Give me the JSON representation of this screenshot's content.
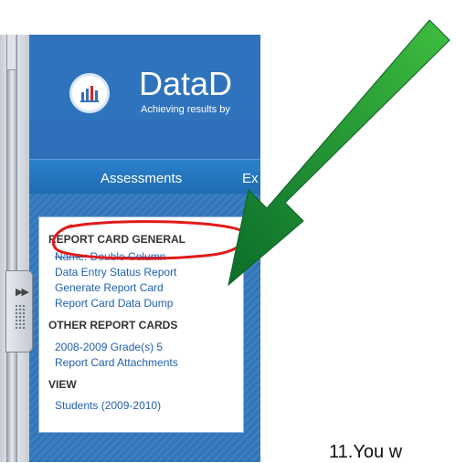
{
  "app": {
    "brand": "DataD",
    "tagline": "Achieving results by"
  },
  "nav": {
    "items": [
      {
        "label": "Assessments"
      },
      {
        "label": "Ex"
      }
    ]
  },
  "menu": {
    "sections": [
      {
        "heading": "REPORT CARD GENERAL",
        "links": [
          {
            "label": "Name: Double Column"
          },
          {
            "label": "Data Entry Status Report"
          },
          {
            "label": "Generate Report Card"
          },
          {
            "label": "Report Card Data Dump"
          }
        ]
      },
      {
        "heading": "OTHER REPORT CARDS",
        "links": [
          {
            "label": "2008-2009 Grade(s) 5"
          },
          {
            "label": "Report Card Attachments"
          }
        ]
      },
      {
        "heading": "VIEW",
        "links": [
          {
            "label": "Students (2009-2010)"
          }
        ]
      }
    ]
  },
  "annotation": {
    "caption": "11.You w",
    "highlight_color": "#e01b1b",
    "arrow_color": "#138a2e"
  },
  "colors": {
    "header": "#2f73bd",
    "navbar": "#1f6bb0",
    "link": "#1f5fae"
  }
}
